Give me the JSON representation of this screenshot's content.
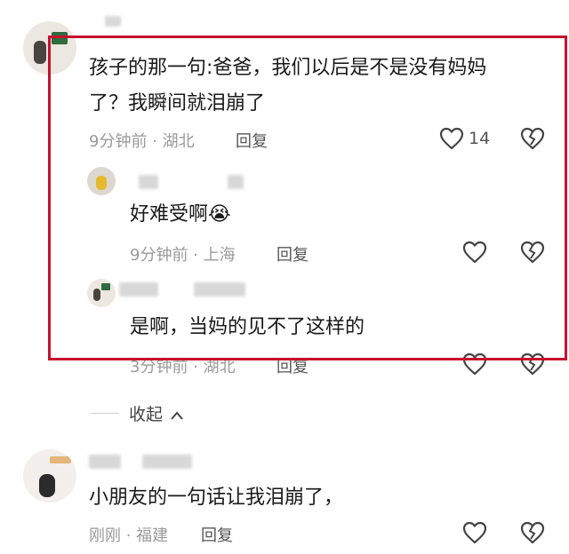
{
  "comments": {
    "main": {
      "text_line1": "孩子的那一句:爸爸，我们以后是不是没有妈妈",
      "text_line2": "了？我瞬间就泪崩了",
      "meta": "9分钟前 · 湖北",
      "reply_label": "回复",
      "like_count": "14"
    },
    "reply1": {
      "text": "好难受啊",
      "emoji": "😭",
      "meta": "9分钟前 · 上海",
      "reply_label": "回复"
    },
    "reply2": {
      "text": "是啊，当妈的见不了这样的",
      "meta": "3分钟前 · 湖北",
      "reply_label": "回复"
    },
    "collapse_label": "收起",
    "second": {
      "text": "小朋友的一句话让我泪崩了，",
      "meta": "刚刚 · 福建",
      "reply_label": "回复"
    }
  },
  "icons": {
    "like": "heart-outline-icon",
    "dislike": "broken-heart-icon",
    "collapse": "chevron-up-icon"
  },
  "colors": {
    "highlight_border": "#c8102e",
    "meta_gray": "#9a9a9a"
  }
}
